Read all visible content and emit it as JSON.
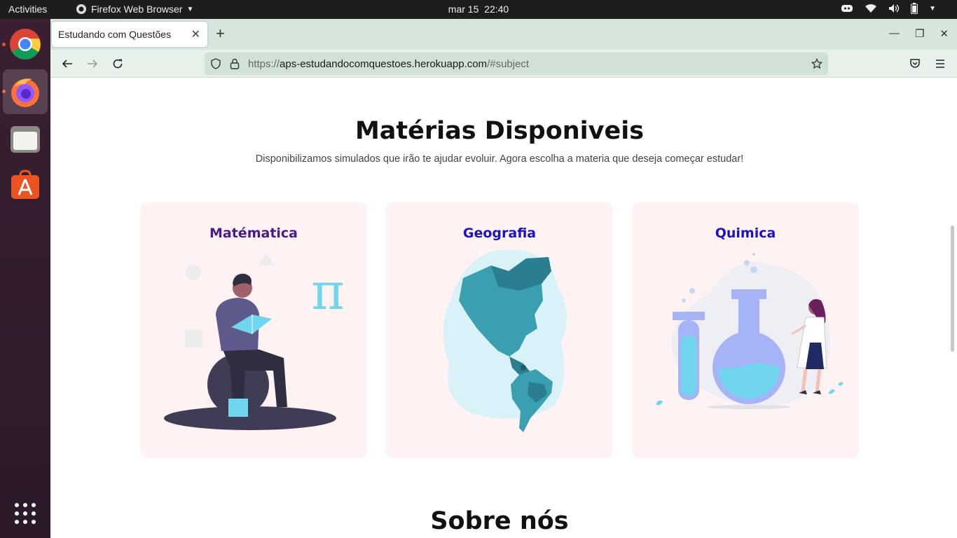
{
  "system": {
    "activities": "Activities",
    "app_name": "Firefox Web Browser",
    "date": "mar 15",
    "time": "22:40"
  },
  "browser": {
    "tab_title": "Estudando com Questões",
    "url_scheme": "https://",
    "url_host": "aps-estudandocomquestoes.herokuapp.com",
    "url_path": "/#subject"
  },
  "page": {
    "heading": "Matérias Disponiveis",
    "subheading": "Disponibilizamos simulados que irão te ajudar evoluir. Agora escolha a materia que deseja começar estudar!",
    "cards": [
      {
        "label": "Matématica",
        "color": "#4a1a8c"
      },
      {
        "label": "Geografia",
        "color": "#1a12c8"
      },
      {
        "label": "Quimica",
        "color": "#1a12c8"
      }
    ],
    "about_heading": "Sobre nós"
  },
  "colors": {
    "card_bg": "#fef2f2",
    "accent_cyan": "#6fd6ee",
    "ubuntu_orange": "#e95420"
  }
}
